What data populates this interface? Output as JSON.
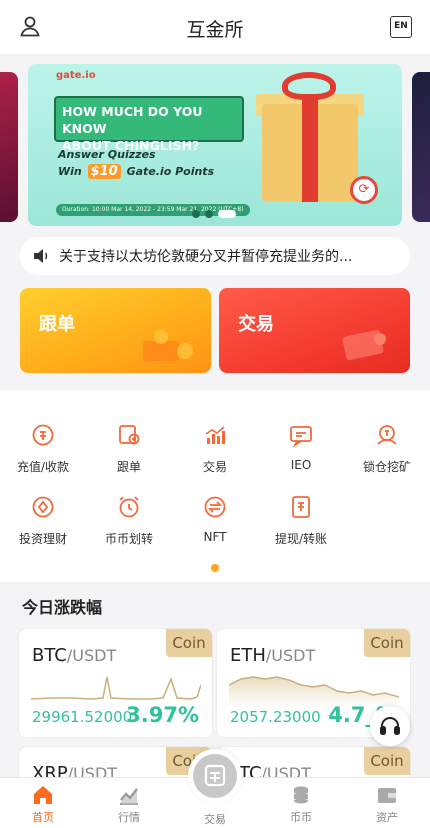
{
  "header": {
    "title": "互金所",
    "lang_badge": "EN"
  },
  "banner": {
    "logo": "gate.io",
    "headline_line1": "HOW MUCH DO YOU KNOW",
    "headline_line2": "ABOUT CHINGLISH?",
    "sub_line1": "Answer Quizzes",
    "sub_prefix": "Win",
    "amount": "$10",
    "sub_suffix": "Gate.io Points",
    "duration": "Duration: 10:00 Mar 14, 2022 - 23:59 Mar 21, 2022 (UTC+8)",
    "slide_count": 3,
    "active_slide": 3
  },
  "notice": {
    "text": "关于支持以太坊伦敦硬分叉并暂停充提业务的..."
  },
  "quick_cards": [
    {
      "label": "跟单"
    },
    {
      "label": "交易"
    }
  ],
  "menu": [
    {
      "label": "充值/收款",
      "icon": "deposit-icon"
    },
    {
      "label": "跟单",
      "icon": "copy-trade-icon"
    },
    {
      "label": "交易",
      "icon": "trade-chart-icon"
    },
    {
      "label": "IEO",
      "icon": "ieo-chat-icon"
    },
    {
      "label": "锁仓挖矿",
      "icon": "lock-mining-icon"
    },
    {
      "label": "投资理财",
      "icon": "invest-icon"
    },
    {
      "label": "币币划转",
      "icon": "transfer-clock-icon"
    },
    {
      "label": "NFT",
      "icon": "nft-icon"
    },
    {
      "label": "提现/转账",
      "icon": "withdraw-icon"
    }
  ],
  "section": {
    "title": "今日涨跌幅"
  },
  "coins": [
    {
      "base": "BTC",
      "quote": "/USDT",
      "tag": "Coin",
      "price": "29961.52000",
      "change": "3.97%"
    },
    {
      "base": "ETH",
      "quote": "/USDT",
      "tag": "Coin",
      "price": "2057.23000",
      "change": "4.7_%"
    },
    {
      "base": "XRP",
      "quote": "/USDT",
      "tag": "Coin",
      "price": "",
      "change": ""
    },
    {
      "base": "_TC",
      "quote": "/USDT",
      "tag": "Coin",
      "price": "",
      "change": ""
    }
  ],
  "tabbar": [
    {
      "label": "首页",
      "icon": "home-icon",
      "active": true
    },
    {
      "label": "行情",
      "icon": "market-icon",
      "active": false
    },
    {
      "label": "交易",
      "icon": "trade-icon",
      "active": false
    },
    {
      "label": "币币",
      "icon": "coins-icon",
      "active": false
    },
    {
      "label": "资产",
      "icon": "wallet-icon",
      "active": false
    }
  ],
  "colors": {
    "accent": "#ff6a20",
    "up": "#2ec39b",
    "tag_bg": "#e8cf9d"
  }
}
